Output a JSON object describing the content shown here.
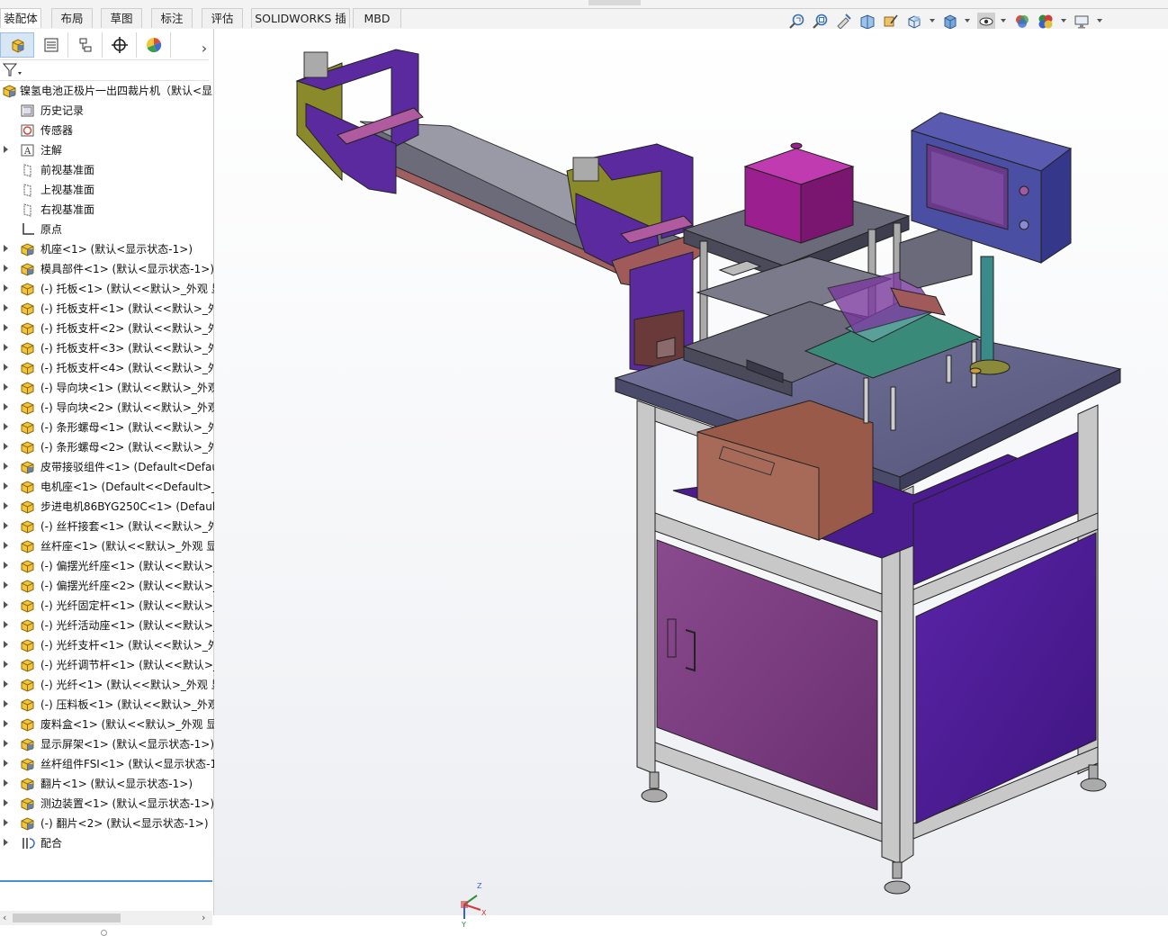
{
  "tabs": [
    "装配体",
    "布局",
    "草图",
    "标注",
    "评估",
    "SOLIDWORKS 插件",
    "MBD"
  ],
  "active_tab": "装配体",
  "view_toolbar": [
    "zoom-to-fit-icon",
    "zoom-area-icon",
    "previous-view-icon",
    "section-view-icon",
    "dynamic-annotation-icon",
    "view-orientation-icon",
    "display-style-icon",
    "hide-show-icon",
    "edit-appearance-icon",
    "apply-scene-icon",
    "view-settings-icon"
  ],
  "panel_tabs": [
    "featuremanager-icon",
    "propertymanager-icon",
    "configurationmanager-icon",
    "dimxpert-icon",
    "displaymanager-icon"
  ],
  "tree": {
    "root": "镍氢电池正极片一出四裁片机（默认<显",
    "items": [
      {
        "label": "历史记录",
        "icon": "history-icon",
        "exp": false
      },
      {
        "label": "传感器",
        "icon": "sensor-icon",
        "exp": false
      },
      {
        "label": "注解",
        "icon": "annotation-icon",
        "exp": true
      },
      {
        "label": "前视基准面",
        "icon": "plane-icon",
        "exp": false
      },
      {
        "label": "上视基准面",
        "icon": "plane-icon",
        "exp": false
      },
      {
        "label": "右视基准面",
        "icon": "plane-icon",
        "exp": false
      },
      {
        "label": "原点",
        "icon": "origin-icon",
        "exp": false
      },
      {
        "label": "机座<1> (默认<显示状态-1>)",
        "icon": "assembly-icon",
        "exp": true
      },
      {
        "label": "模具部件<1> (默认<显示状态-1>)",
        "icon": "assembly-icon",
        "exp": true
      },
      {
        "label": "(-) 托板<1> (默认<<默认>_外观 显",
        "icon": "part-icon",
        "exp": true
      },
      {
        "label": "(-) 托板支杆<1> (默认<<默认>_外",
        "icon": "part-icon",
        "exp": true
      },
      {
        "label": "(-) 托板支杆<2> (默认<<默认>_外",
        "icon": "part-icon",
        "exp": true
      },
      {
        "label": "(-) 托板支杆<3> (默认<<默认>_外",
        "icon": "part-icon",
        "exp": true
      },
      {
        "label": "(-) 托板支杆<4> (默认<<默认>_外",
        "icon": "part-icon",
        "exp": true
      },
      {
        "label": "(-) 导向块<1> (默认<<默认>_外观",
        "icon": "part-icon",
        "exp": true
      },
      {
        "label": "(-) 导向块<2> (默认<<默认>_外观",
        "icon": "part-icon",
        "exp": true
      },
      {
        "label": "(-) 条形螺母<1> (默认<<默认>_外",
        "icon": "part-icon",
        "exp": true
      },
      {
        "label": "(-) 条形螺母<2> (默认<<默认>_外",
        "icon": "part-icon",
        "exp": true
      },
      {
        "label": "皮带接驳组件<1> (Default<Defau",
        "icon": "assembly-icon",
        "exp": true
      },
      {
        "label": "电机座<1> (Default<<Default>_夕",
        "icon": "part-icon",
        "exp": true
      },
      {
        "label": "步进电机86BYG250C<1> (Default",
        "icon": "part-icon",
        "exp": true
      },
      {
        "label": "(-) 丝杆接套<1> (默认<<默认>_外",
        "icon": "part-icon",
        "exp": true
      },
      {
        "label": "丝杆座<1> (默认<<默认>_外观 显",
        "icon": "part-icon",
        "exp": true
      },
      {
        "label": "(-) 偏摆光纤座<1> (默认<<默认>_",
        "icon": "part-icon",
        "exp": true
      },
      {
        "label": "(-) 偏摆光纤座<2> (默认<<默认>_",
        "icon": "part-icon",
        "exp": true
      },
      {
        "label": "(-) 光纤固定杆<1> (默认<<默认>_",
        "icon": "part-icon",
        "exp": true
      },
      {
        "label": "(-) 光纤活动座<1> (默认<<默认>_",
        "icon": "part-icon",
        "exp": true
      },
      {
        "label": "(-) 光纤支杆<1> (默认<<默认>_外",
        "icon": "part-icon",
        "exp": true
      },
      {
        "label": "(-) 光纤调节杆<1> (默认<<默认>_",
        "icon": "part-icon",
        "exp": true
      },
      {
        "label": "(-) 光纤<1> (默认<<默认>_外观 显",
        "icon": "part-icon",
        "exp": true
      },
      {
        "label": "(-) 压料板<1> (默认<<默认>_外观",
        "icon": "part-icon",
        "exp": true
      },
      {
        "label": "废料盒<1> (默认<<默认>_外观 显",
        "icon": "part-icon",
        "exp": true
      },
      {
        "label": "显示屏架<1> (默认<显示状态-1>)",
        "icon": "assembly-icon",
        "exp": true
      },
      {
        "label": "丝杆组件FSI<1> (默认<显示状态-1",
        "icon": "assembly-icon",
        "exp": true
      },
      {
        "label": "翻片<1> (默认<显示状态-1>)",
        "icon": "assembly-icon",
        "exp": true
      },
      {
        "label": "测边装置<1> (默认<显示状态-1>)",
        "icon": "assembly-icon",
        "exp": true
      },
      {
        "label": "(-) 翻片<2> (默认<显示状态-1>)",
        "icon": "assembly-icon",
        "exp": true
      },
      {
        "label": "配合",
        "icon": "mates-icon",
        "exp": true
      }
    ]
  },
  "triad": {
    "x": "X",
    "y": "Y",
    "z": "Z"
  },
  "colors": {
    "frame": "#c8c8c8",
    "panel_purple": "#7a3a80",
    "inner_purple": "#4a1c8e",
    "table_top": "#6a6a8a",
    "motor_magenta": "#9b1f8e",
    "screen_blue": "#4b4fa3",
    "accent_blue": "#4a90d9"
  }
}
